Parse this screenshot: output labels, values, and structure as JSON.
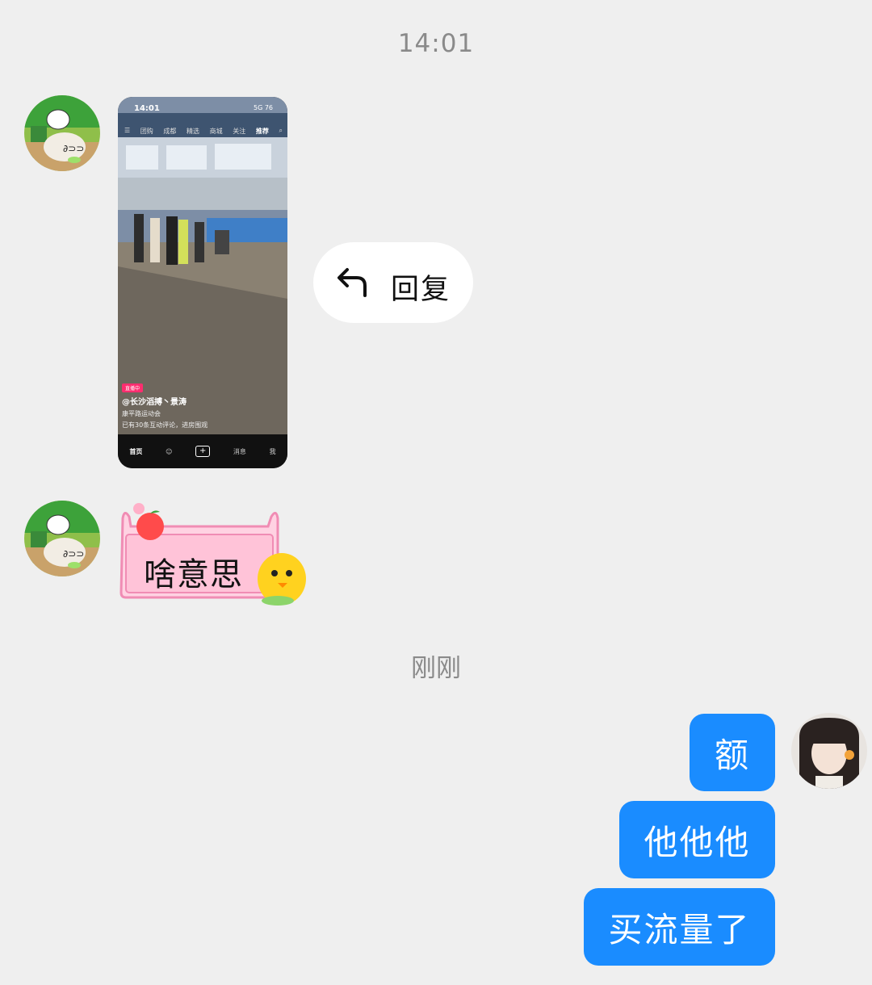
{
  "timestamps": {
    "first": "14:01",
    "second": "刚刚"
  },
  "video_card": {
    "status_time": "14:01",
    "status_right": "5G 76",
    "tabs": [
      "团购",
      "成都",
      "精选",
      "商城",
      "关注",
      "推荐"
    ],
    "live_badge": "直播中",
    "username": "@长沙滔搏丶景涛",
    "description": "康平路运动会",
    "comments": "已有30条互动评论，进房围观",
    "nav": [
      "首页",
      "消息",
      "我"
    ]
  },
  "reply_action": {
    "label": "回复",
    "icon": "reply-arrow-icon"
  },
  "sticker_message": {
    "text": "啥意思"
  },
  "my_messages": [
    "额",
    "他他他",
    "买流量了"
  ],
  "colors": {
    "bubble": "#1a8cff",
    "background": "#efefef"
  }
}
